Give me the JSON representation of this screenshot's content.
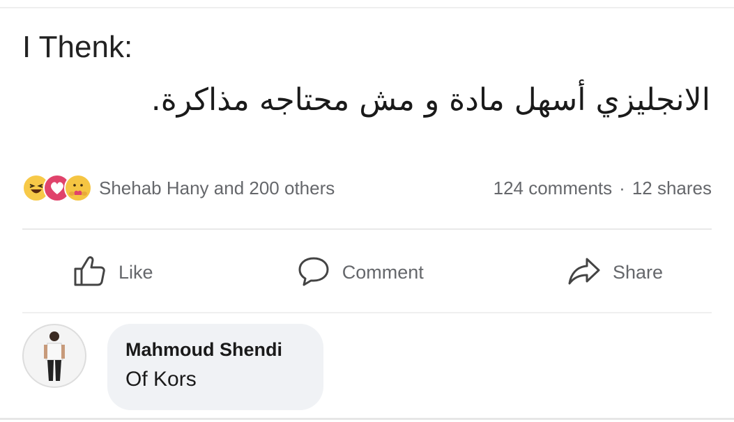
{
  "post": {
    "line1": "I Thenk:",
    "line2": "الانجليزي أسهل مادة و مش محتاجه مذاكرة."
  },
  "reactions": {
    "icons": [
      "haha-icon",
      "love-icon",
      "care-icon"
    ],
    "summary": "Shehab Hany and 200 others"
  },
  "stats": {
    "comments": "124 comments",
    "separator": "·",
    "shares": "12 shares"
  },
  "actions": {
    "like": "Like",
    "comment": "Comment",
    "share": "Share"
  },
  "comment": {
    "author": "Mahmoud Shendi",
    "text": "Of Kors"
  },
  "colors": {
    "text_primary": "#1a1a1a",
    "text_secondary": "#65676b",
    "bubble_bg": "#f0f2f5",
    "haha": "#f7c948",
    "love": "#e0436b",
    "care": "#f5c542"
  }
}
